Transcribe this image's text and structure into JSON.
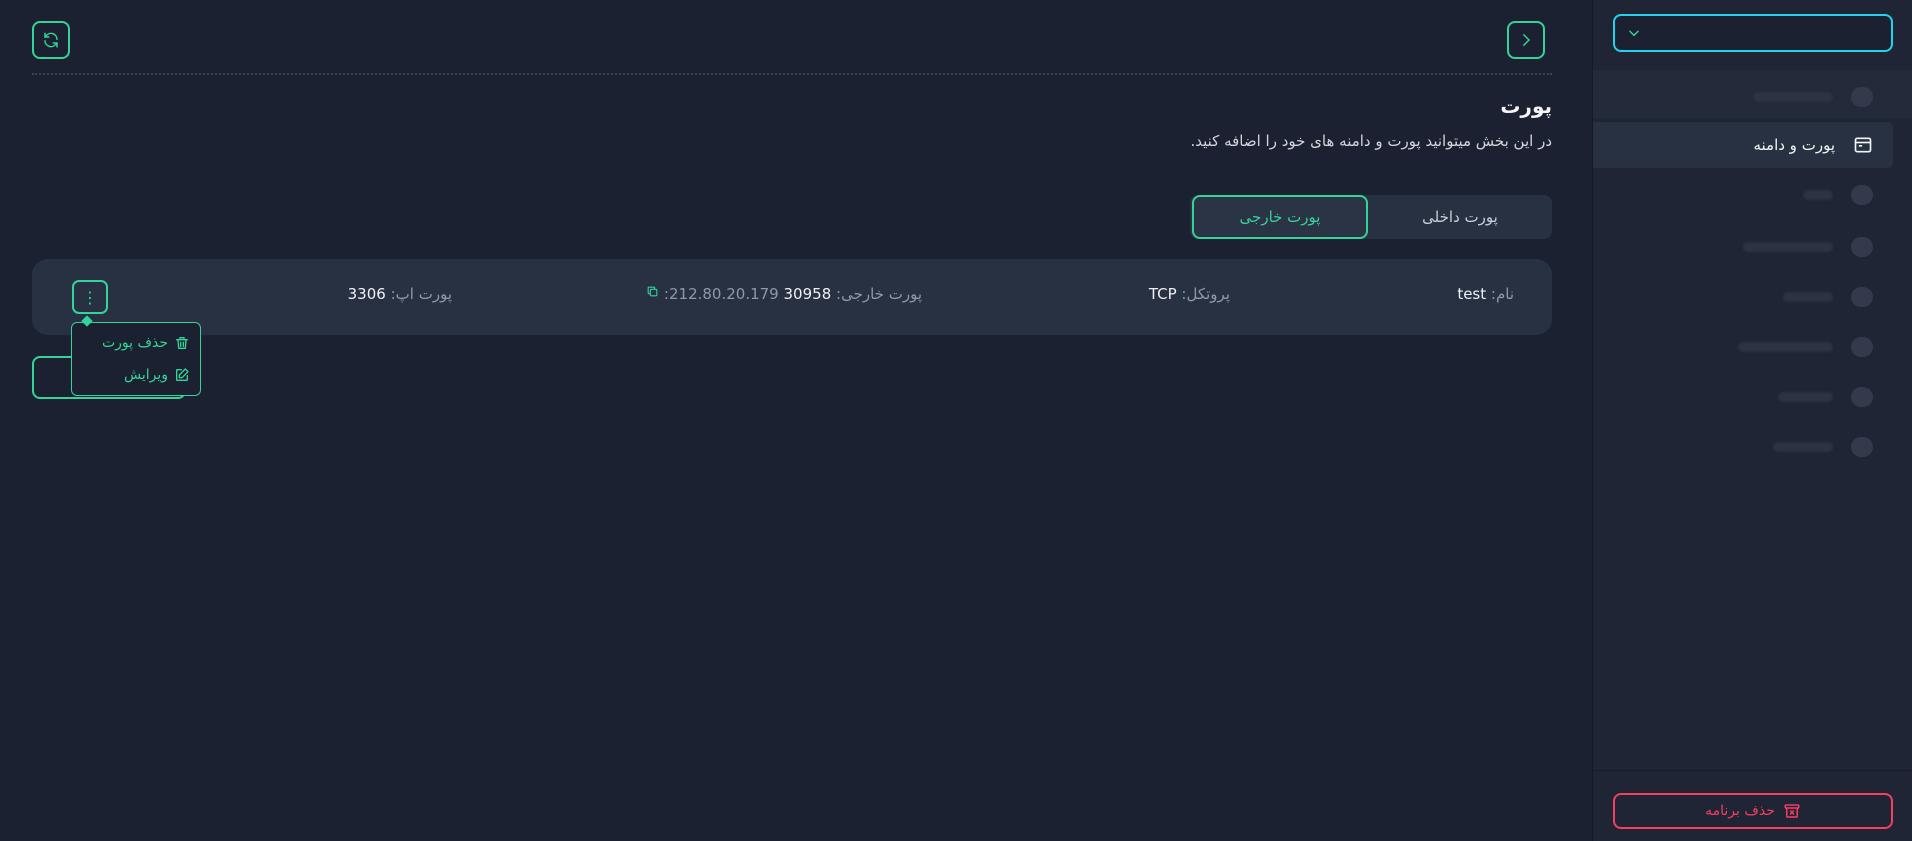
{
  "colors": {
    "accent": "#34d399",
    "danger": "#f43f5e",
    "select_border": "#22d3ee"
  },
  "header": {
    "back_icon": "chevron-right-icon",
    "refresh_icon": "refresh-icon"
  },
  "page": {
    "title": "پورت",
    "description": "در این بخش میتوانید پورت و دامنه های خود را اضافه کنید."
  },
  "tabs": [
    {
      "label": "پورت داخلی",
      "active": false
    },
    {
      "label": "پورت خارجی",
      "active": true
    }
  ],
  "port": {
    "name_label": "نام:",
    "name_value": "test",
    "protocol_label": "پروتکل:",
    "protocol_value": "TCP",
    "external_label": "پورت خارجی:",
    "external_port": "30958",
    "external_ip": "212.80.20.179:",
    "app_port_label": "پورت اپ:",
    "app_port_value": "3306"
  },
  "menu": {
    "delete_label": "حذف پورت",
    "edit_label": "ویرایش"
  },
  "sidebar": {
    "active_item": "پورت و دامنه",
    "delete_app_label": "حذف برنامه"
  }
}
